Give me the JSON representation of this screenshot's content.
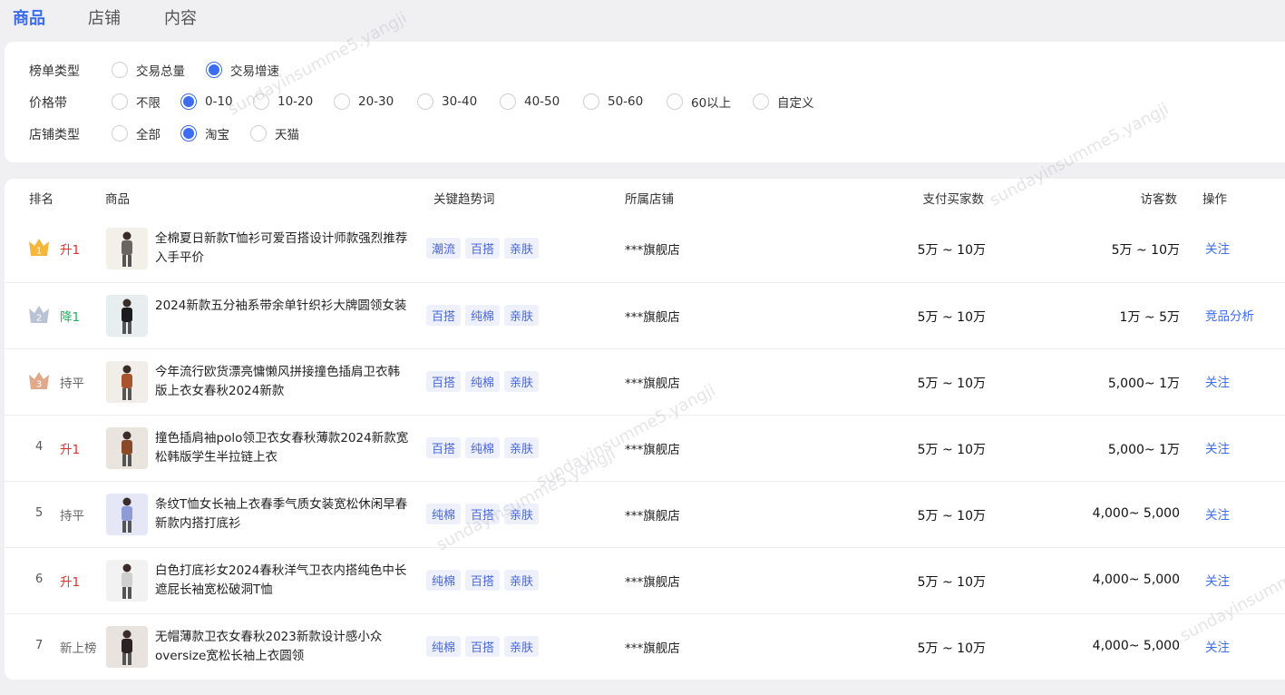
{
  "tabs": [
    {
      "label": "商品",
      "active": true
    },
    {
      "label": "店铺",
      "active": false
    },
    {
      "label": "内容",
      "active": false
    }
  ],
  "filters": {
    "list_type": {
      "label": "榜单类型",
      "options": [
        "交易总量",
        "交易增速"
      ],
      "selected": 1
    },
    "price_band": {
      "label": "价格带",
      "options": [
        "不限",
        "0-10",
        "10-20",
        "20-30",
        "30-40",
        "40-50",
        "50-60",
        "60以上",
        "自定义"
      ],
      "selected": 1
    },
    "shop_type": {
      "label": "店铺类型",
      "options": [
        "全部",
        "淘宝",
        "天猫"
      ],
      "selected": 1
    }
  },
  "table": {
    "headers": {
      "rank": "排名",
      "product": "商品",
      "keywords": "关键趋势词",
      "shop": "所属店铺",
      "buyers": "支付买家数",
      "visitors": "访客数",
      "action": "操作"
    },
    "rows": [
      {
        "rank": "1",
        "trend": "升1",
        "trend_type": "up",
        "title": "全棉夏日新款T恤衫可爱百搭设计师款强烈推荐入手平价",
        "tags": [
          "潮流",
          "百搭",
          "亲肤"
        ],
        "shop": "***旗舰店",
        "buyers": "5万 ~ 10万",
        "visitors": "5万 ~ 10万",
        "action": "关注"
      },
      {
        "rank": "2",
        "trend": "降1",
        "trend_type": "down",
        "title": "2024新款五分袖系带余单针织衫大牌圆领女装",
        "tags": [
          "百搭",
          "纯棉",
          "亲肤"
        ],
        "shop": "***旗舰店",
        "buyers": "5万 ~ 10万",
        "visitors": "1万 ~ 5万",
        "action": "竞品分析"
      },
      {
        "rank": "3",
        "trend": "持平",
        "trend_type": "flat",
        "title": "今年流行欧货漂亮慵懒风拼接撞色插肩卫衣韩版上衣女春秋2024新款",
        "tags": [
          "百搭",
          "纯棉",
          "亲肤"
        ],
        "shop": "***旗舰店",
        "buyers": "5万 ~ 10万",
        "visitors": "5,000~ 1万",
        "action": "关注"
      },
      {
        "rank": "4",
        "trend": "升1",
        "trend_type": "up",
        "title": "撞色插肩袖polo领卫衣女春秋薄款2024新款宽松韩版学生半拉链上衣",
        "tags": [
          "百搭",
          "纯棉",
          "亲肤"
        ],
        "shop": "***旗舰店",
        "buyers": "5万 ~ 10万",
        "visitors": "5,000~ 1万",
        "action": "关注"
      },
      {
        "rank": "5",
        "trend": "持平",
        "trend_type": "flat",
        "title": "条纹T恤女长袖上衣春季气质女装宽松休闲早春新款内搭打底衫",
        "tags": [
          "纯棉",
          "百搭",
          "亲肤"
        ],
        "shop": "***旗舰店",
        "buyers": "5万 ~ 10万",
        "visitors": "4,000~ 5,000",
        "action": "关注"
      },
      {
        "rank": "6",
        "trend": "升1",
        "trend_type": "up",
        "title": "白色打底衫女2024春秋洋气卫衣内搭纯色中长遮屁长袖宽松破洞T恤",
        "tags": [
          "纯棉",
          "百搭",
          "亲肤"
        ],
        "shop": "***旗舰店",
        "buyers": "5万 ~ 10万",
        "visitors": "4,000~ 5,000",
        "action": "关注"
      },
      {
        "rank": "7",
        "trend": "新上榜",
        "trend_type": "new",
        "title": "无帽薄款卫衣女春秋2023新款设计感小众oversize宽松长袖上衣圆领",
        "tags": [
          "纯棉",
          "百搭",
          "亲肤"
        ],
        "shop": "***旗舰店",
        "buyers": "5万 ~ 10万",
        "visitors": "4,000~ 5,000",
        "action": "关注"
      }
    ]
  },
  "colors": {
    "accent": "#3c6cf0",
    "up": "#e0312a",
    "down": "#1fb35a",
    "gold": "#f5b73b",
    "silver": "#b9c3d4",
    "bronze": "#e0a98a"
  },
  "watermark": "sundayinsumme5.yangji"
}
